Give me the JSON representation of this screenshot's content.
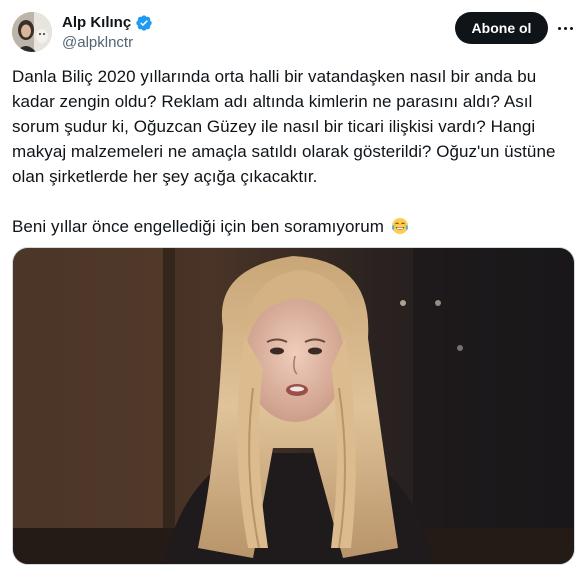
{
  "author": {
    "display_name": "Alp Kılınç",
    "handle": "@alpklnctr",
    "verified": true,
    "avatar_icon": "avatar-photo"
  },
  "actions": {
    "follow_label": "Abone ol",
    "more_icon": "more-dots-icon"
  },
  "tweet": {
    "lines": [
      "Danla Biliç 2020 yıllarında orta halli bir vatandaşken nasıl bir anda bu",
      "kadar zengin oldu? Reklam adı altında kimlerin ne parasını aldı? Asıl",
      "sorum şudur ki, Oğuzcan Güzey ile nasıl bir ticari ilişkisi vardı? Hangi",
      "makyaj malzemeleri ne amaçla satıldı olarak gösterildi?  Oğuz'un üstüne",
      "olan şirketlerde her şey açığa çıkacaktır."
    ],
    "second_paragraph": "Beni yıllar önce engellediği için ben soramıyorum",
    "emoji": "crying-laughing-emoji"
  },
  "media": {
    "type": "photo"
  },
  "colors": {
    "text": "#0f1419",
    "secondary": "#536471",
    "verified_blue": "#1d9bf0",
    "button_bg": "#0f1419"
  }
}
